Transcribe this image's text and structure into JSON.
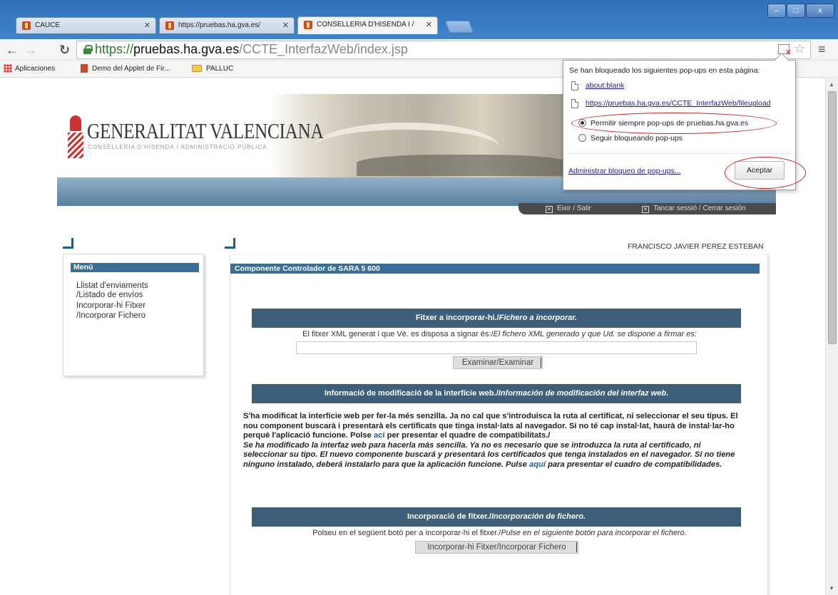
{
  "browser": {
    "tabs": [
      {
        "title": "CAUCE"
      },
      {
        "title": "https://pruebas.ha.gva.es/"
      },
      {
        "title": "CONSELLERIA D'HISENDA I /"
      }
    ],
    "window_controls": {
      "minimize": "–",
      "maximize": "□",
      "close": "x"
    },
    "url": {
      "scheme": "https://",
      "host": "pruebas.ha.gva.es",
      "path": "/CCTE_InterfazWeb/index.jsp"
    },
    "bookmarks": [
      "Aplicaciones",
      "Demo del Applet de Fir...",
      "PALLUC"
    ]
  },
  "popup": {
    "message": "Se han bloqueado los siguientes pop-ups en esta página:",
    "links": [
      "about:blank",
      "https://pruebas.ha.gva.es/CCTE_InterfazWeb/fileupload"
    ],
    "option_allow": "Permitir siempre pop-ups de pruebas.ha.gva.es",
    "option_block": "Seguir bloqueando pop-ups",
    "selected": "allow",
    "manage_link": "Administrar bloqueo de pop-ups...",
    "accept": "Aceptar"
  },
  "page": {
    "logo": {
      "title": "GENERALITAT VALENCIANA",
      "subtitle": "CONSELLERIA D'HISENDA I ADMINISTRACIÓ PÚBLICA"
    },
    "session": {
      "exit": "Eixir / Salir",
      "close_session": "Tancar sessió / Cerrar sesión"
    },
    "user": "FRANCISCO JAVIER PEREZ ESTEBAN",
    "menu": {
      "title": "Menú",
      "items": [
        "Llistat d'enviaments",
        "/Listado de envíos",
        "Incorporar-hi Fitxer",
        "/Incorporar Fichero"
      ]
    },
    "main": {
      "title": "Componente Controlador de SARA 5 600",
      "section1": {
        "title_val": "Fitxer a incorporar-hi./",
        "title_es": "Fichero a incorporar.",
        "desc_val": "El fitxer XML generat i que Vè. es disposa a signar és:/",
        "desc_es": "El fichero XML generado y que Ud. se dispone a firmar es:",
        "button": "Examinar/Examinar"
      },
      "section2": {
        "title_val": "Informació de modificació de la interfície web./",
        "title_es": "Información de modificación del interfaz web."
      },
      "para": {
        "val_1": "S'ha modificat la interfície web per fer-la més senzilla. Ja no cal que s'introduisca la ruta al certificat, ni seleccionar el seu tipus. El nou component buscarà i presentarà els certificats que tinga instal·lats al navegador. Si no té cap instal·lat, haurà de instal·lar-ho perquè l'aplicació funcione. Polse ",
        "val_link": "ací",
        "val_2": " per presentar el quadre de compatibilitats./",
        "es_1": "Se ha modificado la interfaz web para hacerla más sencilla. Ya no es necesario que se introduzca la ruta al certificado, ni seleccionar su tipo. El nuevo componente buscará y presentará los certificados que tenga instalados en el navegador. Si no tiene ninguno instalado, deberá instalarlo para que la aplicación funcione. Pulse ",
        "es_link": "aquí",
        "es_2": " para presentar el cuadro de compatibilidades."
      },
      "section3": {
        "title_val": "Incorporació de fitxer./",
        "title_es": "Incorporación de fichero.",
        "desc_val": "Polseu en el següent botó per a incorporar-hi el fitxer./",
        "desc_es": "Pulse en el siguiente botón para incorporar el fichero.",
        "button": "Incorporar-hi Fitxer/Incorporar Fichero"
      }
    }
  }
}
